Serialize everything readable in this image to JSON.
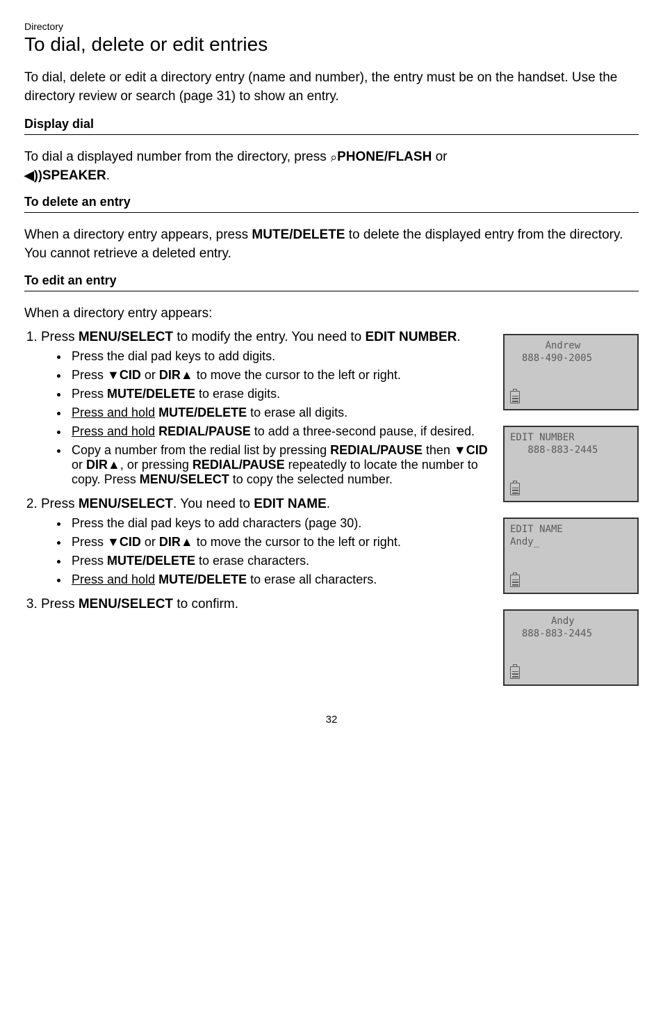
{
  "breadcrumb": "Directory",
  "title": "To dial, delete or edit entries",
  "intro": "To dial, delete or edit a directory entry (name and number), the entry must be on the handset. Use the directory review or search (page 31) to show an entry.",
  "section1": {
    "heading": "Display dial",
    "body_pre": "To dial a displayed number from the directory, press ",
    "phone": "PHONE",
    "flash": "/FLASH",
    "body_mid": " or ",
    "speaker": "SPEAKER",
    "body_end": "."
  },
  "section2": {
    "heading": "To delete an entry",
    "body_pre": "When a directory entry appears, press ",
    "mute": "MUTE",
    "delete": "/DELETE",
    "body_post": " to delete the displayed entry from the directory. You cannot retrieve a deleted entry."
  },
  "section3": {
    "heading": "To edit an entry",
    "lead": "When a directory entry appears:",
    "step1_pre": "Press ",
    "menu": "MENU",
    "select": "/SELECT",
    "step1_mid": " to modify the entry. You need to ",
    "edit_number": "EDIT NUMBER",
    "step1_end": ".",
    "s1_b1": "Press the dial pad keys to add digits.",
    "s1_b2_a": "Press ",
    "down": "▼",
    "cid": "CID",
    "s1_b2_b": " or ",
    "dir": "DIR",
    "up": "▲",
    "s1_b2_c": " to move the cursor to the left or right.",
    "s1_b3_a": "Press ",
    "s1_b3_b": " to erase digits.",
    "s1_b4_a": "Press and hold",
    "s1_b4_b": " to erase all digits.",
    "s1_b5_a": "Press and hold",
    "redial": "REDIAL",
    "pause": "/PAUSE",
    "s1_b5_b": " to add a three-second pause, if desired.",
    "s1_b6_a": "Copy a number from the redial list by pressing ",
    "s1_b6_b": " then ",
    "s1_b6_c": ", or pressing ",
    "s1_b6_d": " repeatedly to locate the number to copy. Press ",
    "s1_b6_e": " to copy the selected number.",
    "step2_pre": "Press ",
    "step2_mid": ". You need to ",
    "edit_name": "EDIT NAME",
    "step2_end": ".",
    "s2_b1": "Press the dial pad keys to add characters (page 30).",
    "s2_b2": " to move the cursor to the left or right.",
    "s2_b3_a": "Press ",
    "s2_b3_b": " to erase characters.",
    "s2_b4_a": "Press and hold",
    "s2_b4_b": " to erase all characters.",
    "step3_pre": "Press ",
    "step3_end": " to confirm."
  },
  "screens": {
    "s1_l1": "      Andrew",
    "s1_l2": "  888-490-2005",
    "s2_l1": "EDIT NUMBER",
    "s2_l2": "   888-883-2445",
    "s3_l1": "EDIT NAME",
    "s3_l2": "Andy_",
    "s4_l1": "       Andy",
    "s4_l2": "  888-883-2445"
  },
  "page_number": "32"
}
